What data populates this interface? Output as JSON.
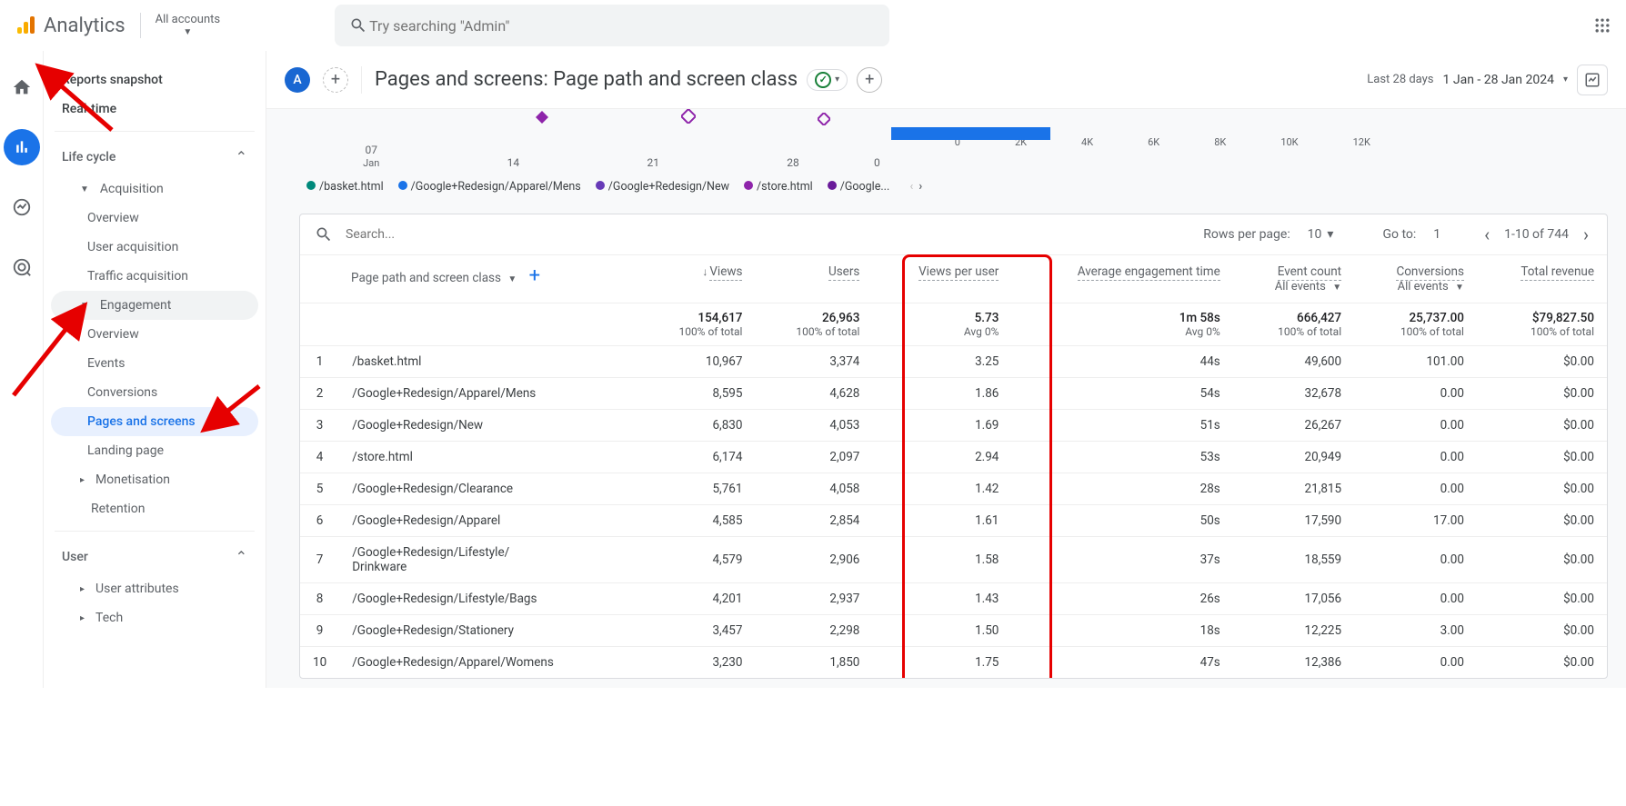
{
  "header": {
    "product": "Analytics",
    "accounts": "All accounts",
    "searchPlaceholder": "Try searching \"Admin\""
  },
  "sidebar": {
    "reportsSnapshot": "Reports snapshot",
    "realtime": "Real-time",
    "lifeCycle": "Life cycle",
    "acquisition": "Acquisition",
    "acq_overview": "Overview",
    "acq_user": "User acquisition",
    "acq_traffic": "Traffic acquisition",
    "engagement": "Engagement",
    "eng_overview": "Overview",
    "eng_events": "Events",
    "eng_conversions": "Conversions",
    "eng_pages": "Pages and screens",
    "eng_landing": "Landing page",
    "monetisation": "Monetisation",
    "retention": "Retention",
    "user": "User",
    "userAttributes": "User attributes",
    "tech": "Tech"
  },
  "page": {
    "titlePrefix": "Pages and screens: ",
    "titleDim": "Page path and screen class",
    "dateLabel": "Last 28 days",
    "dateRange": "1 Jan - 28 Jan 2024"
  },
  "chart_data": {
    "type": "line",
    "xTicks": [
      "07",
      "14",
      "21",
      "28"
    ],
    "xSubLabel": "Jan",
    "yZero": "0",
    "barTicks": [
      "0",
      "2K",
      "4K",
      "6K",
      "8K",
      "10K",
      "12K"
    ],
    "legend": [
      {
        "color": "#00897b",
        "label": "/basket.html"
      },
      {
        "color": "#1a73e8",
        "label": "/Google+Redesign/Apparel/Mens"
      },
      {
        "color": "#673ab7",
        "label": "/Google+Redesign/New"
      },
      {
        "color": "#8e24aa",
        "label": "/store.html"
      },
      {
        "color": "#6a1b9a",
        "label": "/Google..."
      }
    ]
  },
  "table": {
    "searchPlaceholder": "Search...",
    "rowsPerPageLabel": "Rows per page:",
    "rowsPerPage": "10",
    "goToLabel": "Go to:",
    "goTo": "1",
    "pageInfo": "1-10 of 744",
    "dimHeader": "Page path and screen class",
    "columns": {
      "views": "Views",
      "users": "Users",
      "viewsPerUser": "Views per user",
      "avgEngTime": "Average engagement time",
      "eventCount": "Event count",
      "eventCountSub": "All events",
      "conversions": "Conversions",
      "conversionsSub": "All events",
      "totalRevenue": "Total revenue"
    },
    "totals": {
      "views": "154,617",
      "viewsSub": "100% of total",
      "users": "26,963",
      "usersSub": "100% of total",
      "vpu": "5.73",
      "vpuSub": "Avg 0%",
      "aet": "1m 58s",
      "aetSub": "Avg 0%",
      "events": "666,427",
      "eventsSub": "100% of total",
      "conv": "25,737.00",
      "convSub": "100% of total",
      "rev": "$79,827.50",
      "revSub": "100% of total"
    },
    "rows": [
      {
        "i": "1",
        "path": "/basket.html",
        "views": "10,967",
        "users": "3,374",
        "vpu": "3.25",
        "aet": "44s",
        "events": "49,600",
        "conv": "101.00",
        "rev": "$0.00"
      },
      {
        "i": "2",
        "path": "/Google+Redesign/Apparel/Mens",
        "views": "8,595",
        "users": "4,628",
        "vpu": "1.86",
        "aet": "54s",
        "events": "32,678",
        "conv": "0.00",
        "rev": "$0.00"
      },
      {
        "i": "3",
        "path": "/Google+Redesign/New",
        "views": "6,830",
        "users": "4,053",
        "vpu": "1.69",
        "aet": "51s",
        "events": "26,267",
        "conv": "0.00",
        "rev": "$0.00"
      },
      {
        "i": "4",
        "path": "/store.html",
        "views": "6,174",
        "users": "2,097",
        "vpu": "2.94",
        "aet": "53s",
        "events": "20,949",
        "conv": "0.00",
        "rev": "$0.00"
      },
      {
        "i": "5",
        "path": "/Google+Redesign/Clearance",
        "views": "5,761",
        "users": "4,058",
        "vpu": "1.42",
        "aet": "28s",
        "events": "21,815",
        "conv": "0.00",
        "rev": "$0.00"
      },
      {
        "i": "6",
        "path": "/Google+Redesign/Apparel",
        "views": "4,585",
        "users": "2,854",
        "vpu": "1.61",
        "aet": "50s",
        "events": "17,590",
        "conv": "17.00",
        "rev": "$0.00"
      },
      {
        "i": "7",
        "path": "/Google+Redesign/Lifestyle/ Drinkware",
        "views": "4,579",
        "users": "2,906",
        "vpu": "1.58",
        "aet": "37s",
        "events": "18,559",
        "conv": "0.00",
        "rev": "$0.00"
      },
      {
        "i": "8",
        "path": "/Google+Redesign/Lifestyle/Bags",
        "views": "4,201",
        "users": "2,937",
        "vpu": "1.43",
        "aet": "26s",
        "events": "17,056",
        "conv": "0.00",
        "rev": "$0.00"
      },
      {
        "i": "9",
        "path": "/Google+Redesign/Stationery",
        "views": "3,457",
        "users": "2,298",
        "vpu": "1.50",
        "aet": "18s",
        "events": "12,225",
        "conv": "3.00",
        "rev": "$0.00"
      },
      {
        "i": "10",
        "path": "/Google+Redesign/Apparel/Womens",
        "views": "3,230",
        "users": "1,850",
        "vpu": "1.75",
        "aet": "47s",
        "events": "12,386",
        "conv": "0.00",
        "rev": "$0.00"
      }
    ]
  }
}
